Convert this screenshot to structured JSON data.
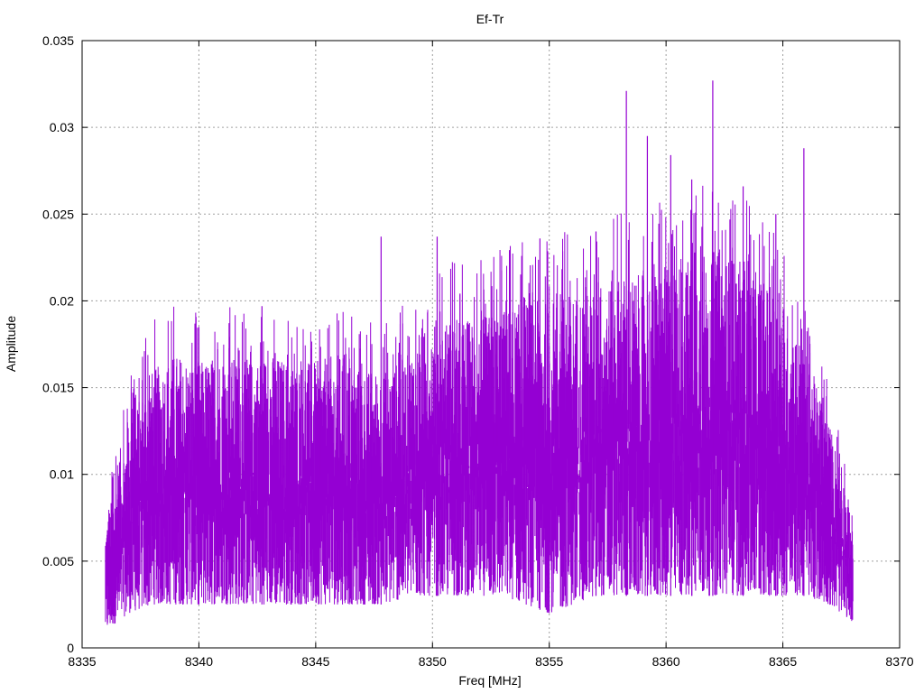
{
  "chart_data": {
    "type": "line",
    "title": "Ef-Tr",
    "xlabel": "Freq [MHz]",
    "ylabel": "Amplitude",
    "xlim": [
      8335,
      8370
    ],
    "ylim": [
      0,
      0.035
    ],
    "xticks": [
      "8335",
      "8340",
      "8345",
      "8350",
      "8355",
      "8360",
      "8365",
      "8370"
    ],
    "yticks": [
      "0",
      "0.005",
      "0.01",
      "0.015",
      "0.02",
      "0.025",
      "0.03",
      "0.035"
    ],
    "grid": true,
    "line_color": "#9400d3",
    "series": [
      {
        "x": [
          8336.0,
          8337.0,
          8338.0,
          8339.0,
          8340.0,
          8341.0,
          8342.0,
          8343.0,
          8344.0,
          8345.0,
          8346.0,
          8347.0,
          8348.0,
          8349.0,
          8350.0,
          8351.0,
          8352.0,
          8353.0,
          8354.0,
          8355.0,
          8356.0,
          8357.0,
          8358.0,
          8359.0,
          8360.0,
          8361.0,
          8362.0,
          8363.0,
          8364.0,
          8365.0,
          8366.0,
          8367.0,
          8368.0
        ],
        "high": [
          0.007,
          0.013,
          0.016,
          0.017,
          0.0165,
          0.017,
          0.0165,
          0.017,
          0.0165,
          0.0165,
          0.017,
          0.016,
          0.016,
          0.017,
          0.019,
          0.019,
          0.019,
          0.0195,
          0.02,
          0.02,
          0.0205,
          0.0205,
          0.0215,
          0.0215,
          0.022,
          0.0225,
          0.023,
          0.0225,
          0.0215,
          0.02,
          0.017,
          0.013,
          0.0075
        ],
        "low": [
          0.001,
          0.002,
          0.0025,
          0.0025,
          0.0025,
          0.0025,
          0.0025,
          0.0025,
          0.0025,
          0.0025,
          0.0025,
          0.0025,
          0.0025,
          0.003,
          0.003,
          0.003,
          0.003,
          0.003,
          0.0025,
          0.002,
          0.0025,
          0.003,
          0.003,
          0.003,
          0.003,
          0.003,
          0.003,
          0.003,
          0.003,
          0.003,
          0.003,
          0.0025,
          0.0015
        ]
      }
    ],
    "peaks": [
      {
        "x": 8340.0,
        "y": 0.0185
      },
      {
        "x": 8342.7,
        "y": 0.0197
      },
      {
        "x": 8347.8,
        "y": 0.0237
      },
      {
        "x": 8350.2,
        "y": 0.0237
      },
      {
        "x": 8354.6,
        "y": 0.0236
      },
      {
        "x": 8357.0,
        "y": 0.024
      },
      {
        "x": 8358.3,
        "y": 0.0321
      },
      {
        "x": 8359.2,
        "y": 0.0295
      },
      {
        "x": 8360.2,
        "y": 0.0284
      },
      {
        "x": 8361.1,
        "y": 0.027
      },
      {
        "x": 8362.0,
        "y": 0.0327
      },
      {
        "x": 8363.3,
        "y": 0.0266
      },
      {
        "x": 8364.7,
        "y": 0.025
      },
      {
        "x": 8365.9,
        "y": 0.0288
      }
    ]
  }
}
